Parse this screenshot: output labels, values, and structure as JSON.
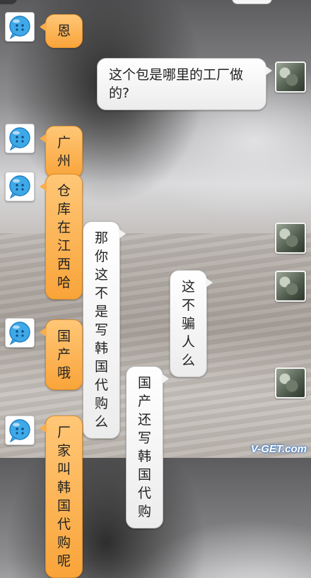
{
  "chat": {
    "messages": [
      {
        "side": "in",
        "text": "恩"
      },
      {
        "side": "out",
        "text": "这个包是哪里的工厂做的?"
      },
      {
        "side": "in",
        "text": "广州"
      },
      {
        "side": "in",
        "text": "仓库在江西哈"
      },
      {
        "side": "out",
        "text": "那你这不是写韩国代购么"
      },
      {
        "side": "out",
        "text": "这不骗人么"
      },
      {
        "side": "in",
        "text": "国产哦"
      },
      {
        "side": "out",
        "text": "国产还写韩国代购"
      },
      {
        "side": "in",
        "text": "厂家叫韩国代购呢"
      }
    ]
  },
  "watermark": "V-GET.com",
  "colors": {
    "incoming_bubble": "#f9a43a",
    "outgoing_bubble": "#ffffff",
    "bot_avatar": "#3fa9e8"
  },
  "icons": {
    "bot_avatar": "speech-bubble-face-icon",
    "user_avatar": "photo-avatar"
  }
}
